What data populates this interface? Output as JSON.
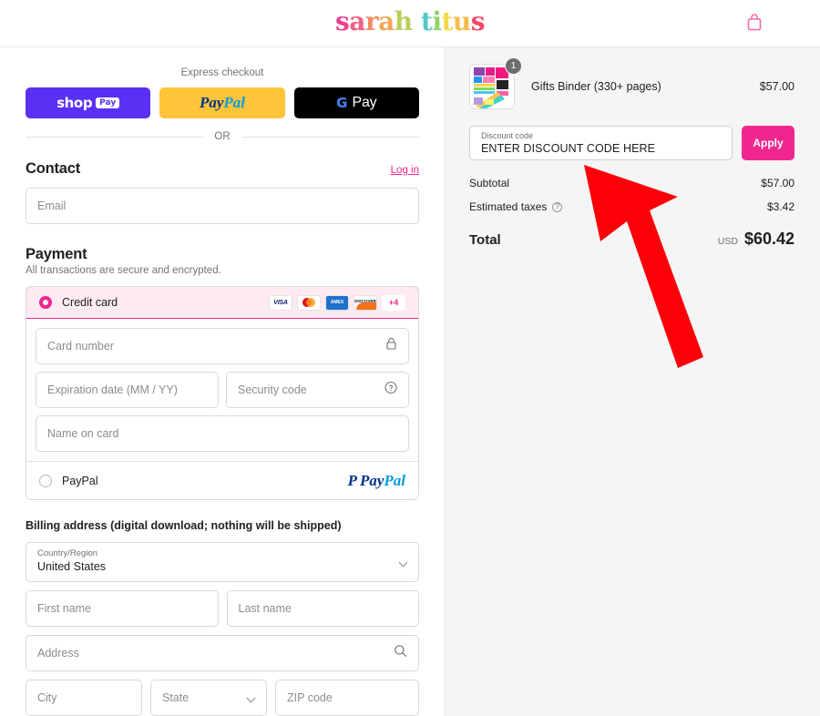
{
  "header": {
    "logo_text": "sarah titus",
    "logo_letters": [
      {
        "ch": "s",
        "color": "#ef3f8e"
      },
      {
        "ch": "a",
        "color": "#f2607f"
      },
      {
        "ch": "r",
        "color": "#f58b63"
      },
      {
        "ch": "a",
        "color": "#f0a85a"
      },
      {
        "ch": "h",
        "color": "#b9d05e"
      },
      {
        "ch": " ",
        "color": "#ffffff"
      },
      {
        "ch": "t",
        "color": "#55c8c8"
      },
      {
        "ch": "i",
        "color": "#8ed36a"
      },
      {
        "ch": "t",
        "color": "#f2d84b"
      },
      {
        "ch": "u",
        "color": "#f6b94a"
      },
      {
        "ch": "s",
        "color": "#ef4b6b"
      }
    ],
    "cart_icon": "shopping-bag-icon",
    "cart_icon_color": "#f06ba8"
  },
  "express": {
    "title": "Express checkout",
    "buttons": [
      {
        "name": "shop-pay",
        "word": "shop",
        "badge": "Pay",
        "bg": "#5a31f4"
      },
      {
        "name": "paypal",
        "word_a": "Pay",
        "word_b": "Pal",
        "bg": "#ffc439"
      },
      {
        "name": "google-pay",
        "g": "G",
        "word": "Pay",
        "bg": "#000000"
      }
    ],
    "divider_text": "OR"
  },
  "contact": {
    "title": "Contact",
    "login_label": "Log in",
    "email_placeholder": "Email"
  },
  "payment": {
    "title": "Payment",
    "subtitle": "All transactions are secure and encrypted.",
    "methods": [
      {
        "label": "Credit card",
        "selected": true
      },
      {
        "label": "PayPal",
        "selected": false
      }
    ],
    "brands": [
      "VISA",
      "Mastercard",
      "AMEX",
      "DISCOVER",
      "+4"
    ],
    "brand_more_label": "+4",
    "visa_label": "VISA",
    "amex_label": "AMEX",
    "discover_label": "DISCOVER",
    "paypal_brand": "PayPal",
    "fields": {
      "card_number": "Card number",
      "card_number_icon": "lock-icon",
      "expiration": "Expiration date (MM / YY)",
      "security_code": "Security code",
      "security_icon": "question-circle-icon",
      "name_on_card": "Name on card"
    }
  },
  "billing": {
    "title": "Billing address (digital download; nothing will be shipped)",
    "country_label": "Country/Region",
    "country_value": "United States",
    "first_name": "First name",
    "last_name": "Last name",
    "address": "Address",
    "address_icon": "search-icon",
    "city": "City",
    "state": "State",
    "zip": "ZIP code"
  },
  "summary": {
    "item": {
      "name": "Gifts Binder (330+ pages)",
      "price": "$57.00",
      "quantity": "1"
    },
    "discount": {
      "label": "Discount code",
      "value": "ENTER DISCOUNT CODE HERE",
      "apply_label": "Apply"
    },
    "rows": [
      {
        "label": "Subtotal",
        "amount": "$57.00",
        "info": false
      },
      {
        "label": "Estimated taxes",
        "amount": "$3.42",
        "info": true
      }
    ],
    "subtotal_label": "Subtotal",
    "subtotal_amount": "$57.00",
    "taxes_label": "Estimated taxes",
    "taxes_amount": "$3.42",
    "total_label": "Total",
    "currency": "USD",
    "total_amount": "$60.42"
  },
  "annotation": {
    "arrow_color": "#fb0007",
    "arrow_target": "discount-code-input"
  },
  "colors": {
    "accent_pink": "#f0278f",
    "panel_bg": "#f5f5f5",
    "border": "#d9d9d9"
  }
}
